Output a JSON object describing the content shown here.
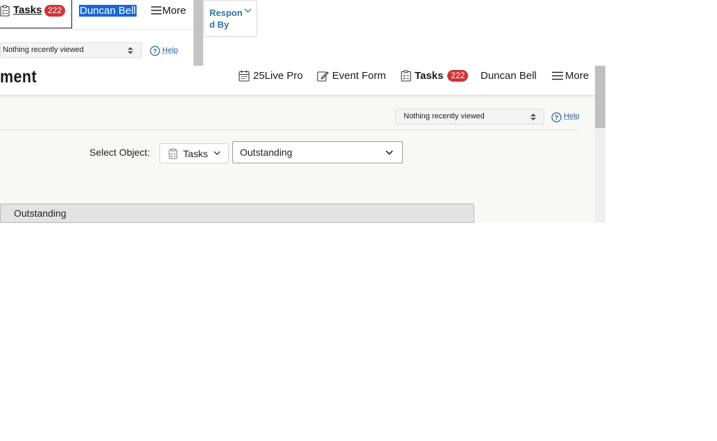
{
  "background_header": {
    "tasks_label": "Tasks",
    "tasks_count": "222",
    "user_name": "Duncan Bell",
    "more_label": "More",
    "recently_viewed": "Nothing recently viewed",
    "help_label": "Help"
  },
  "respond_by": {
    "label": "Respond By"
  },
  "header": {
    "page_title": "ment",
    "nav": {
      "pro_label": "25Live Pro",
      "event_form_label": "Event Form",
      "tasks_label": "Tasks",
      "tasks_count": "222",
      "user_name": "Duncan Bell",
      "more_label": "More"
    }
  },
  "toolbar": {
    "recently_viewed": "Nothing recently viewed",
    "help_label": "Help"
  },
  "filters": {
    "select_object_label": "Select Object:",
    "object_value": "Tasks",
    "state_value": "Outstanding"
  },
  "section": {
    "title": "Outstanding"
  },
  "colors": {
    "badge": "#d13438",
    "link": "#1f5d9c",
    "selection": "#1967d2"
  },
  "icons": [
    "clipboard-icon",
    "calendar-icon",
    "edit-icon",
    "menu-icon",
    "help-icon",
    "chevron-down-icon",
    "sort-arrows-icon"
  ]
}
